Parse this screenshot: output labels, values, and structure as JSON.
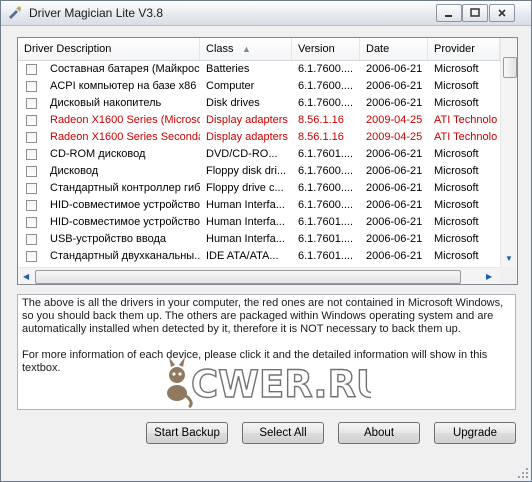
{
  "window": {
    "title": "Driver Magician Lite V3.8"
  },
  "grid": {
    "columns": [
      "Driver Description",
      "Class",
      "Version",
      "Date",
      "Provider"
    ],
    "rows": [
      {
        "desc": "Составная батарея (Майкрос...",
        "class": "Batteries",
        "version": "6.1.7600....",
        "date": "2006-06-21",
        "provider": "Microsoft",
        "red": false
      },
      {
        "desc": "ACPI компьютер на базе x86",
        "class": "Computer",
        "version": "6.1.7600....",
        "date": "2006-06-21",
        "provider": "Microsoft",
        "red": false
      },
      {
        "desc": "Дисковый накопитель",
        "class": "Disk drives",
        "version": "6.1.7600....",
        "date": "2006-06-21",
        "provider": "Microsoft",
        "red": false
      },
      {
        "desc": "Radeon X1600 Series (Microsof...",
        "class": "Display adapters",
        "version": "8.56.1.16",
        "date": "2009-04-25",
        "provider": "ATI Technolo",
        "red": true
      },
      {
        "desc": "Radeon X1600 Series Seconda...",
        "class": "Display adapters",
        "version": "8.56.1.16",
        "date": "2009-04-25",
        "provider": "ATI Technolo",
        "red": true
      },
      {
        "desc": "CD-ROM дисковод",
        "class": "DVD/CD-RO...",
        "version": "6.1.7601....",
        "date": "2006-06-21",
        "provider": "Microsoft",
        "red": false
      },
      {
        "desc": "Дисковод",
        "class": "Floppy disk dri...",
        "version": "6.1.7600....",
        "date": "2006-06-21",
        "provider": "Microsoft",
        "red": false
      },
      {
        "desc": "Стандартный контроллер гиб...",
        "class": "Floppy drive c...",
        "version": "6.1.7600....",
        "date": "2006-06-21",
        "provider": "Microsoft",
        "red": false
      },
      {
        "desc": "HID-совместимое устройство",
        "class": "Human Interfa...",
        "version": "6.1.7600....",
        "date": "2006-06-21",
        "provider": "Microsoft",
        "red": false
      },
      {
        "desc": "HID-совместимое устройство",
        "class": "Human Interfa...",
        "version": "6.1.7601....",
        "date": "2006-06-21",
        "provider": "Microsoft",
        "red": false
      },
      {
        "desc": "USB-устройство ввода",
        "class": "Human Interfa...",
        "version": "6.1.7601....",
        "date": "2006-06-21",
        "provider": "Microsoft",
        "red": false
      },
      {
        "desc": "Стандартный двухканальны...",
        "class": "IDE ATA/ATA...",
        "version": "6.1.7601....",
        "date": "2006-06-21",
        "provider": "Microsoft",
        "red": false
      }
    ]
  },
  "info": {
    "para1": "The above is all the drivers in your computer, the red ones are not contained in Microsoft Windows, so you should back them up. The others are packaged within Windows operating system and are automatically installed when detected by it, therefore it is NOT necessary to back them up.",
    "para2": "For more information of each device, please click it and the detailed information will show in this textbox."
  },
  "watermark": {
    "text": "CWER.RU"
  },
  "buttons": {
    "backup": "Start Backup",
    "select_all": "Select All",
    "about": "About",
    "upgrade": "Upgrade"
  },
  "colors": {
    "missing_driver": "#cc0000"
  }
}
